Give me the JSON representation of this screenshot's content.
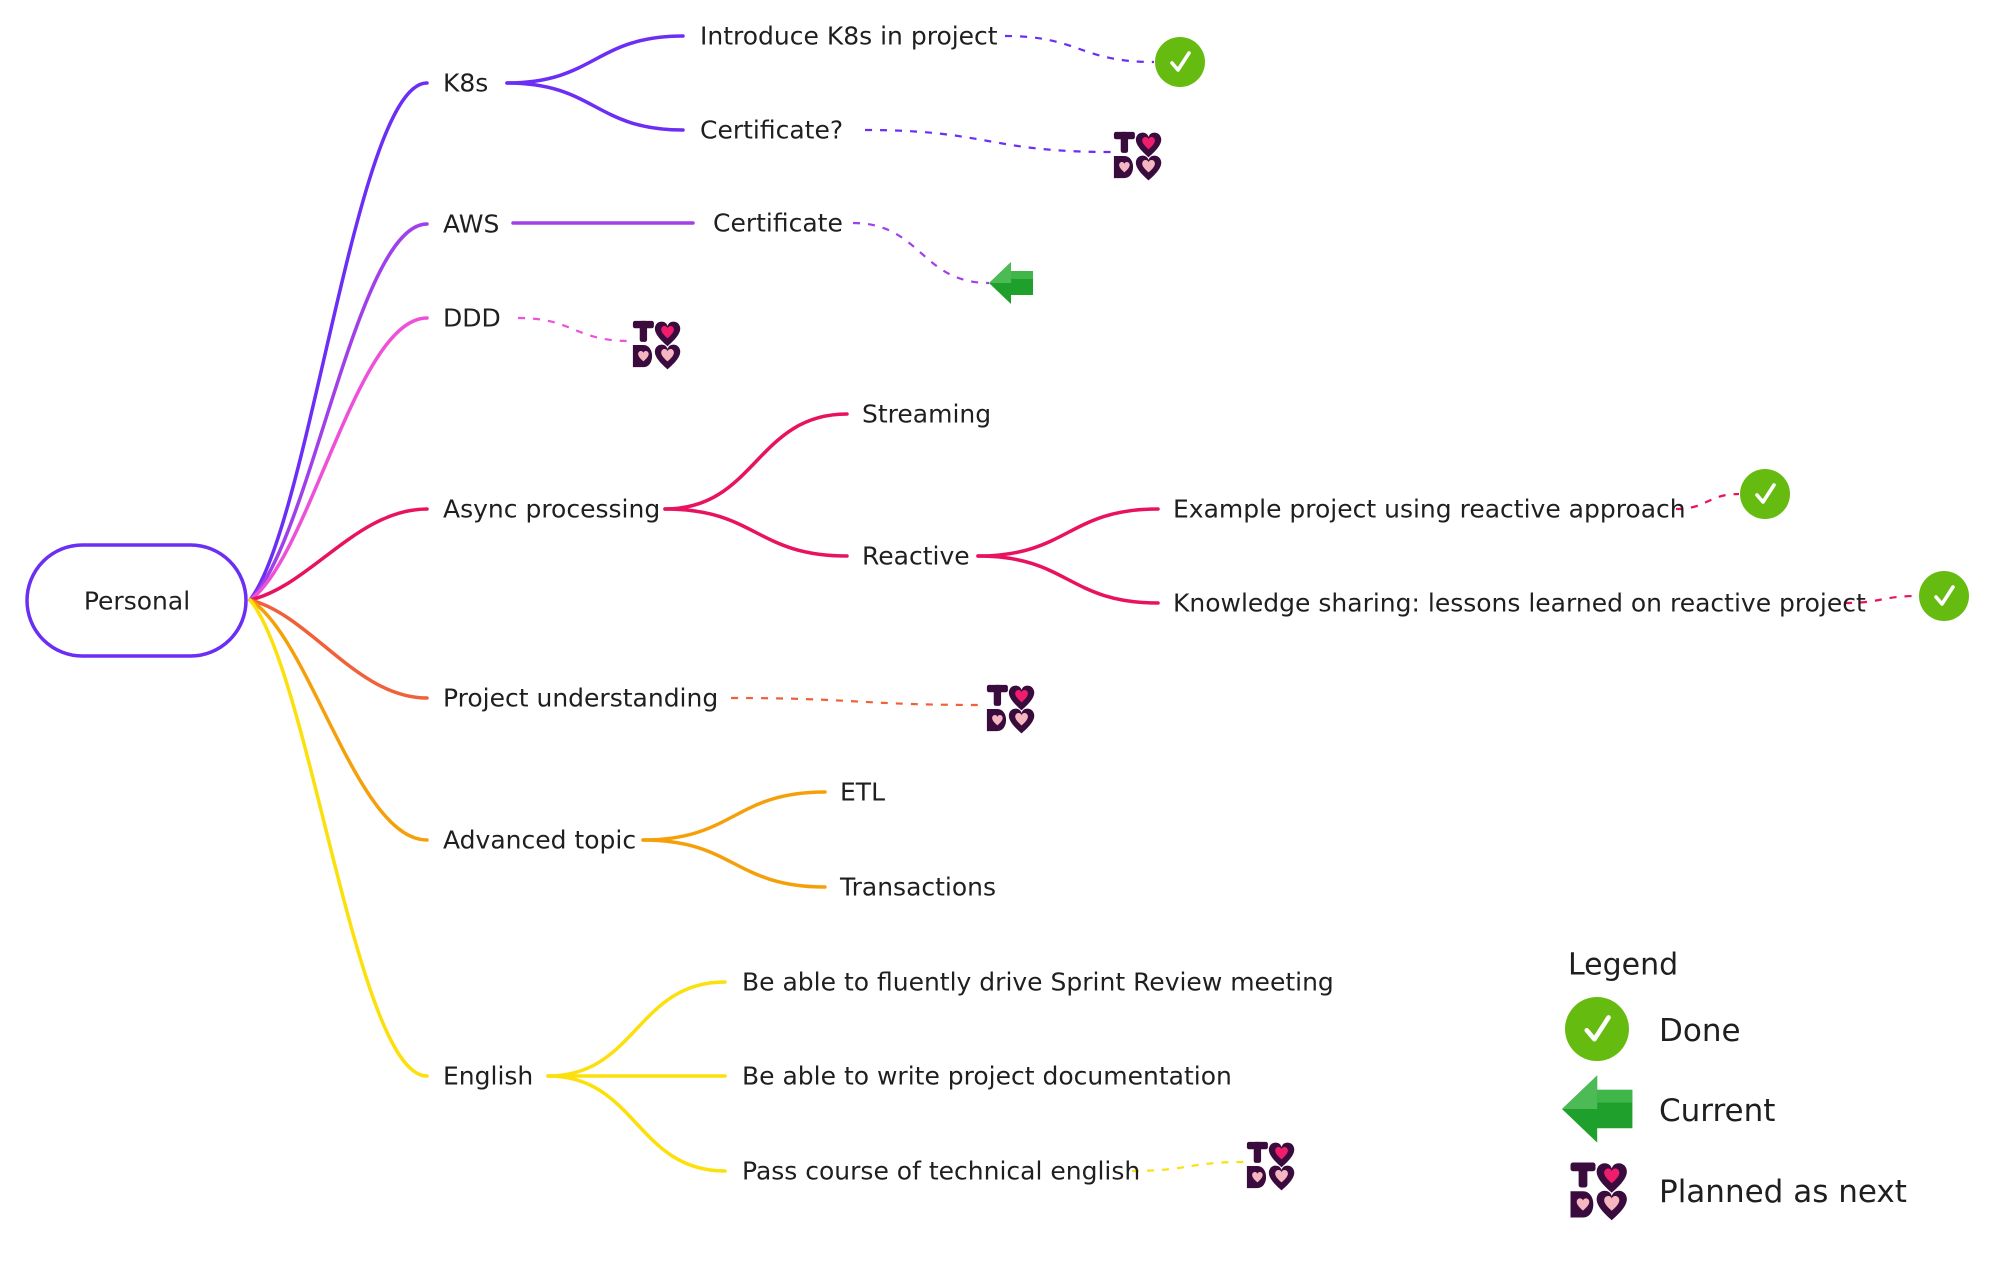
{
  "colors": {
    "k8s": "#6a2ef5",
    "aws": "#a040e8",
    "ddd": "#ee50d8",
    "async": "#e8125f",
    "project": "#f0613a",
    "advanced": "#f5a00a",
    "english": "#fbe00c",
    "done": "#66bb10",
    "current": "#1fa02c",
    "todo_dark": "#3a0c3e",
    "todo_pink": "#f01c6c",
    "todo_light": "#f5b6c0",
    "root_border": "#6a2ef5"
  },
  "mindmap": {
    "root": {
      "label": "Personal"
    },
    "branches": [
      {
        "id": "k8s",
        "label": "K8s",
        "color_key": "k8s",
        "children": [
          {
            "id": "k8s-intro",
            "label": "Introduce K8s in project",
            "status": "done"
          },
          {
            "id": "k8s-cert",
            "label": "Certificate?",
            "status": "todo"
          }
        ]
      },
      {
        "id": "aws",
        "label": "AWS",
        "color_key": "aws",
        "children": [
          {
            "id": "aws-cert",
            "label": "Certificate",
            "status": "current"
          }
        ]
      },
      {
        "id": "ddd",
        "label": "DDD",
        "color_key": "ddd",
        "status": "todo",
        "children": []
      },
      {
        "id": "async",
        "label": "Async processing",
        "color_key": "async",
        "children": [
          {
            "id": "async-streaming",
            "label": "Streaming"
          },
          {
            "id": "async-reactive",
            "label": "Reactive",
            "children": [
              {
                "id": "reactive-example",
                "label": "Example project using reactive approach",
                "status": "done"
              },
              {
                "id": "reactive-knowledge",
                "label": "Knowledge sharing: lessons learned on reactive project",
                "status": "done"
              }
            ]
          }
        ]
      },
      {
        "id": "project",
        "label": "Project understanding",
        "color_key": "project",
        "status": "todo",
        "children": []
      },
      {
        "id": "advanced",
        "label": "Advanced topic",
        "color_key": "advanced",
        "children": [
          {
            "id": "adv-etl",
            "label": "ETL"
          },
          {
            "id": "adv-tx",
            "label": "Transactions"
          }
        ]
      },
      {
        "id": "english",
        "label": "English",
        "color_key": "english",
        "children": [
          {
            "id": "en-sprint",
            "label": "Be able to fluently drive Sprint Review meeting"
          },
          {
            "id": "en-docs",
            "label": "Be able to write project documentation"
          },
          {
            "id": "en-course",
            "label": "Pass course of technical english",
            "status": "todo"
          }
        ]
      }
    ]
  },
  "legend": {
    "title": "Legend",
    "items": [
      {
        "status": "done",
        "icon": "check-circle-icon",
        "label": "Done"
      },
      {
        "status": "current",
        "icon": "arrow-left-icon",
        "label": "Current"
      },
      {
        "status": "todo",
        "icon": "todo-hearts-icon",
        "label": "Planned as next"
      }
    ]
  },
  "icons": {
    "todo_letters": [
      "T",
      "D"
    ]
  }
}
